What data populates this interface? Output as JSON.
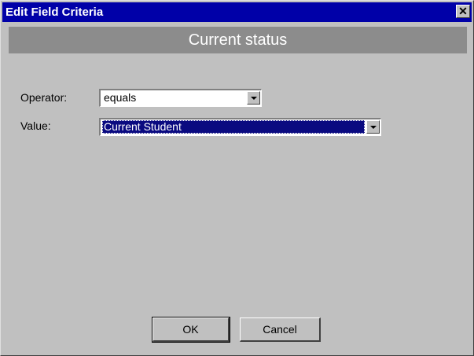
{
  "window": {
    "title": "Edit Field Criteria",
    "close_glyph": "✕"
  },
  "header": {
    "title": "Current status"
  },
  "form": {
    "operator": {
      "label": "Operator:",
      "value": "equals"
    },
    "value": {
      "label": "Value:",
      "value": "Current Student"
    }
  },
  "buttons": {
    "ok": "OK",
    "cancel": "Cancel"
  },
  "icons": {
    "close": "close-icon",
    "dropdown": "chevron-down-icon"
  },
  "colors": {
    "titlebar": "#0000a8",
    "header_band": "#8c8c8c",
    "selection": "#0a0a80",
    "dialog": "#c0c0c0"
  }
}
